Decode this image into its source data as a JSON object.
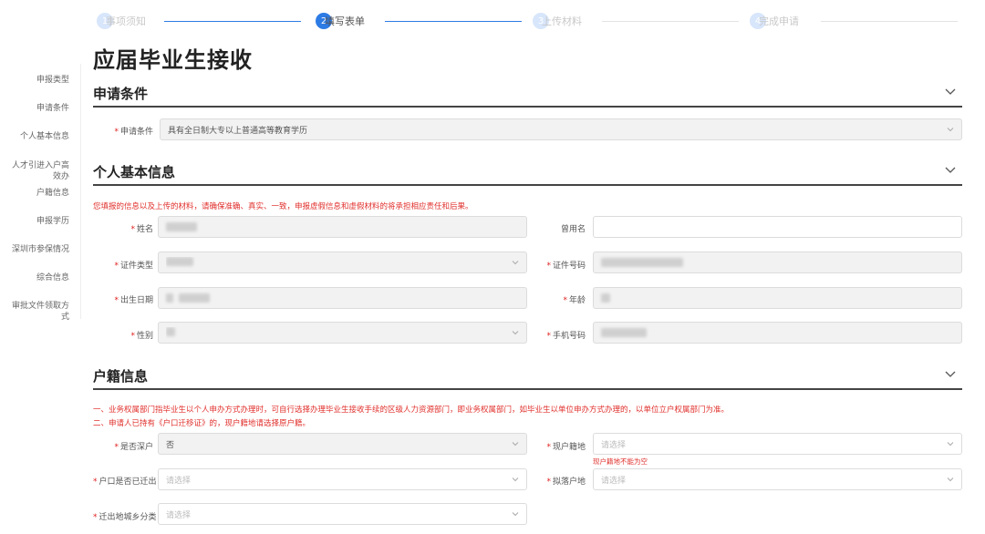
{
  "steps": [
    {
      "num": "1",
      "label": "事项须知"
    },
    {
      "num": "2",
      "label": "填写表单"
    },
    {
      "num": "3",
      "label": "上传材料"
    },
    {
      "num": "4",
      "label": "完成申请"
    }
  ],
  "page_title": "应届毕业生接收",
  "sidebar": {
    "items": [
      {
        "label": "申报类型"
      },
      {
        "label": "申请条件"
      },
      {
        "label": "个人基本信息"
      },
      {
        "label": "人才引进入户高效办"
      },
      {
        "label": "户籍信息"
      },
      {
        "label": "申报学历"
      },
      {
        "label": "深圳市参保情况"
      },
      {
        "label": "综合信息"
      },
      {
        "label": "审批文件领取方式"
      }
    ]
  },
  "sections": {
    "conditions": {
      "title": "申请条件",
      "field_label": "申请条件",
      "field_value": "具有全日制大专以上普通高等教育学历"
    },
    "personal": {
      "title": "个人基本信息",
      "notice": "您填报的信息以及上传的材料，请确保准确、真实、一致，申报虚假信息和虚假材料的将承担相应责任和后果。",
      "name_label": "姓名",
      "alias_label": "曾用名",
      "id_type_label": "证件类型",
      "id_number_label": "证件号码",
      "birth_label": "出生日期",
      "age_label": "年龄",
      "gender_label": "性别",
      "phone_label": "手机号码"
    },
    "household": {
      "title": "户籍信息",
      "notice1": "一、业务权属部门指毕业生以个人申办方式办理时，可自行选择办理毕业生接收手续的区级人力资源部门，即业务权属部门，如毕业生以单位申办方式办理的，以单位立户权属部门为准。",
      "notice2": "二、申请人已持有《户口迁移证》的，现户籍地请选择原户籍。",
      "shenzhen_label": "是否深户",
      "shenzhen_value": "否",
      "current_label": "现户籍地",
      "current_placeholder": "请选择",
      "current_error": "现户籍地不能为空",
      "moved_label": "户口是否已迁出",
      "moved_placeholder": "请选择",
      "settle_label": "拟落户地",
      "settle_placeholder": "请选择",
      "region_label": "迁出地城乡分类",
      "region_placeholder": "请选择"
    }
  }
}
